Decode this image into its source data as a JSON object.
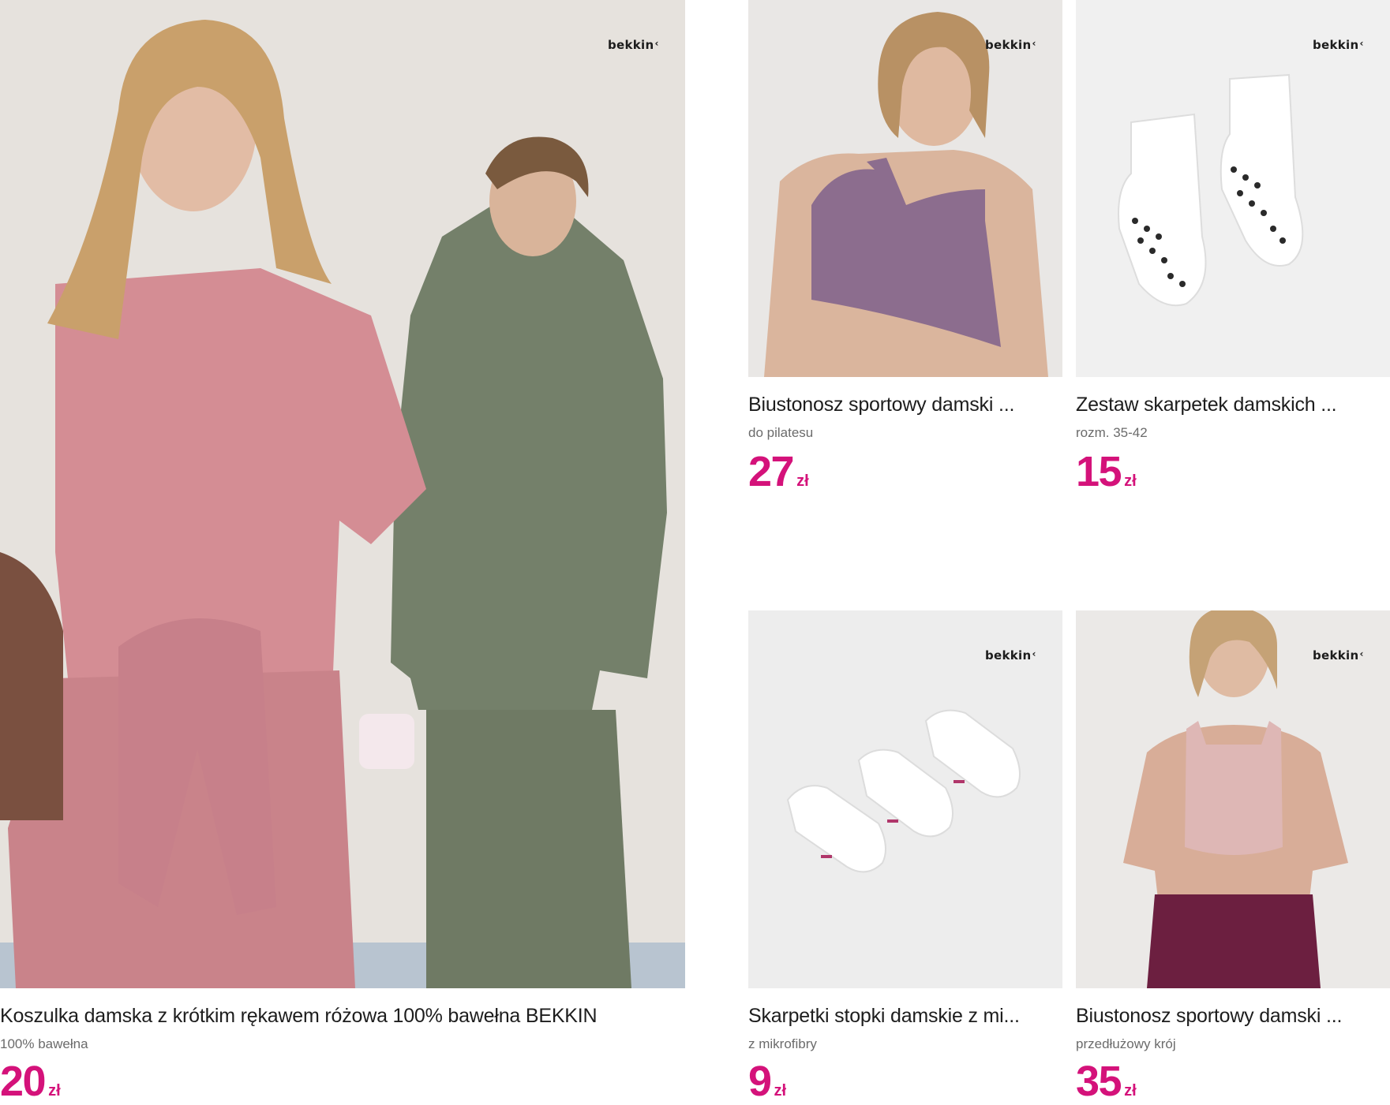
{
  "brand_logo": "bekkin",
  "colors": {
    "price": "#d4127a",
    "title": "#1d1d1d",
    "subtitle": "#6b6b6b",
    "image_bg": "#ececec"
  },
  "products": [
    {
      "title": "Koszulka damska z krótkim rękawem różowa 100% bawełna BEKKIN",
      "subtitle": "100% bawełna",
      "price": "20",
      "currency": "zł"
    },
    {
      "title": "Biustonosz sportowy damski ...",
      "subtitle": "do pilatesu",
      "price": "27",
      "currency": "zł"
    },
    {
      "title": "Zestaw skarpetek damskich ...",
      "subtitle": "rozm. 35-42",
      "price": "15",
      "currency": "zł"
    },
    {
      "title": "Skarpetki stopki damskie z mi...",
      "subtitle": "z mikrofibry",
      "price": "9",
      "currency": "zł"
    },
    {
      "title": "Biustonosz sportowy damski ...",
      "subtitle": "przedłużowy krój",
      "price": "35",
      "currency": "zł"
    }
  ]
}
